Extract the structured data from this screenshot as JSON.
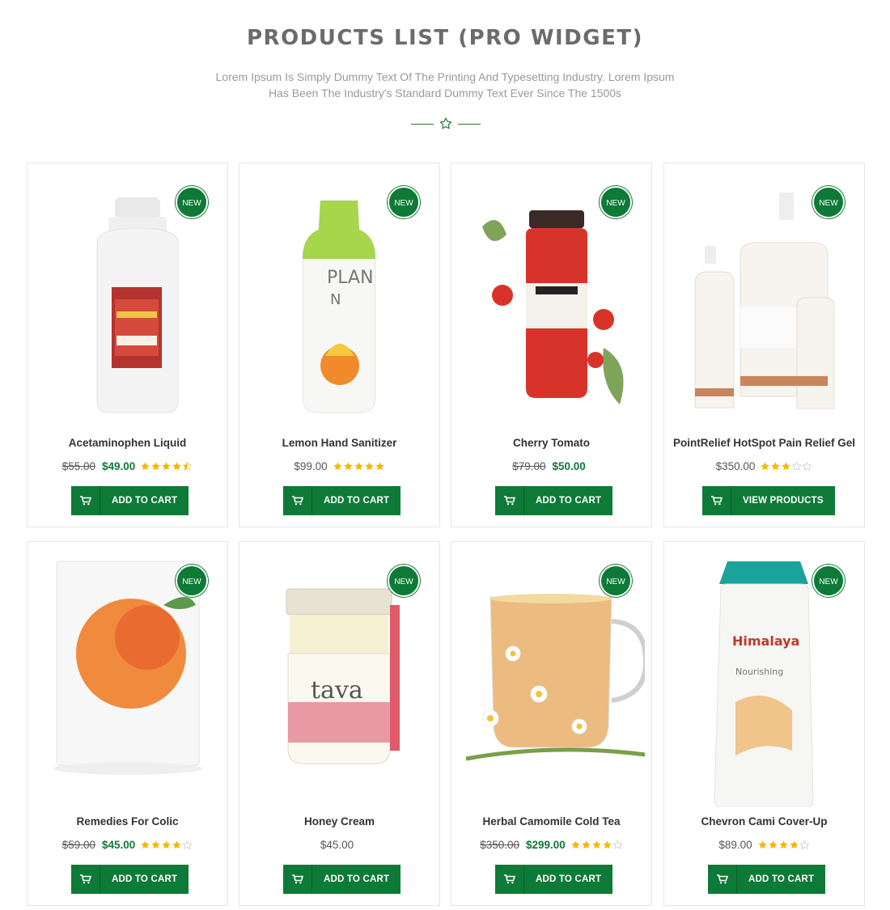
{
  "header": {
    "title": "PRODUCTS LIST (PRO WIDGET)",
    "subtitle_line1": "Lorem Ipsum Is Simply Dummy Text Of The Printing And Typesetting Industry. Lorem Ipsum",
    "subtitle_line2": "Has Been The Industry's Standard Dummy Text Ever Since The 1500s",
    "divider_icon": "star-outline-icon"
  },
  "colors": {
    "accent": "#0e7a37",
    "star": "#f5b800",
    "star_empty": "#c8c8c8",
    "title": "#6b6b6b"
  },
  "products": [
    {
      "name": "Acetaminophen Liquid",
      "badge": "NEW",
      "old_price": "$55.00",
      "price": "$49.00",
      "rating": 4.5,
      "button": "ADD TO CART",
      "icon": "cart-icon"
    },
    {
      "name": "Lemon Hand Sanitizer",
      "badge": "NEW",
      "old_price": "",
      "price": "$99.00",
      "rating": 5,
      "button": "ADD TO CART",
      "icon": "cart-icon"
    },
    {
      "name": "Cherry Tomato",
      "badge": "NEW",
      "old_price": "$79.00",
      "price": "$50.00",
      "rating": 0,
      "button": "ADD TO CART",
      "icon": "cart-icon"
    },
    {
      "name": "PointRelief HotSpot Pain Relief Gel",
      "badge": "NEW",
      "old_price": "",
      "price": "$350.00",
      "rating": 3,
      "button": "VIEW PRODUCTS",
      "icon": "cart-icon"
    },
    {
      "name": "Remedies For Colic",
      "badge": "NEW",
      "old_price": "$59.00",
      "price": "$45.00",
      "rating": 4,
      "button": "ADD TO CART",
      "icon": "cart-icon"
    },
    {
      "name": "Honey Cream",
      "badge": "NEW",
      "old_price": "",
      "price": "$45.00",
      "rating": 0,
      "button": "ADD TO CART",
      "icon": "cart-icon"
    },
    {
      "name": "Herbal Camomile Cold Tea",
      "badge": "NEW",
      "old_price": "$350.00",
      "price": "$299.00",
      "rating": 4,
      "button": "ADD TO CART",
      "icon": "cart-icon"
    },
    {
      "name": "Chevron Cami Cover-Up",
      "badge": "NEW",
      "old_price": "",
      "price": "$89.00",
      "rating": 4,
      "button": "ADD TO CART",
      "icon": "cart-icon"
    }
  ]
}
